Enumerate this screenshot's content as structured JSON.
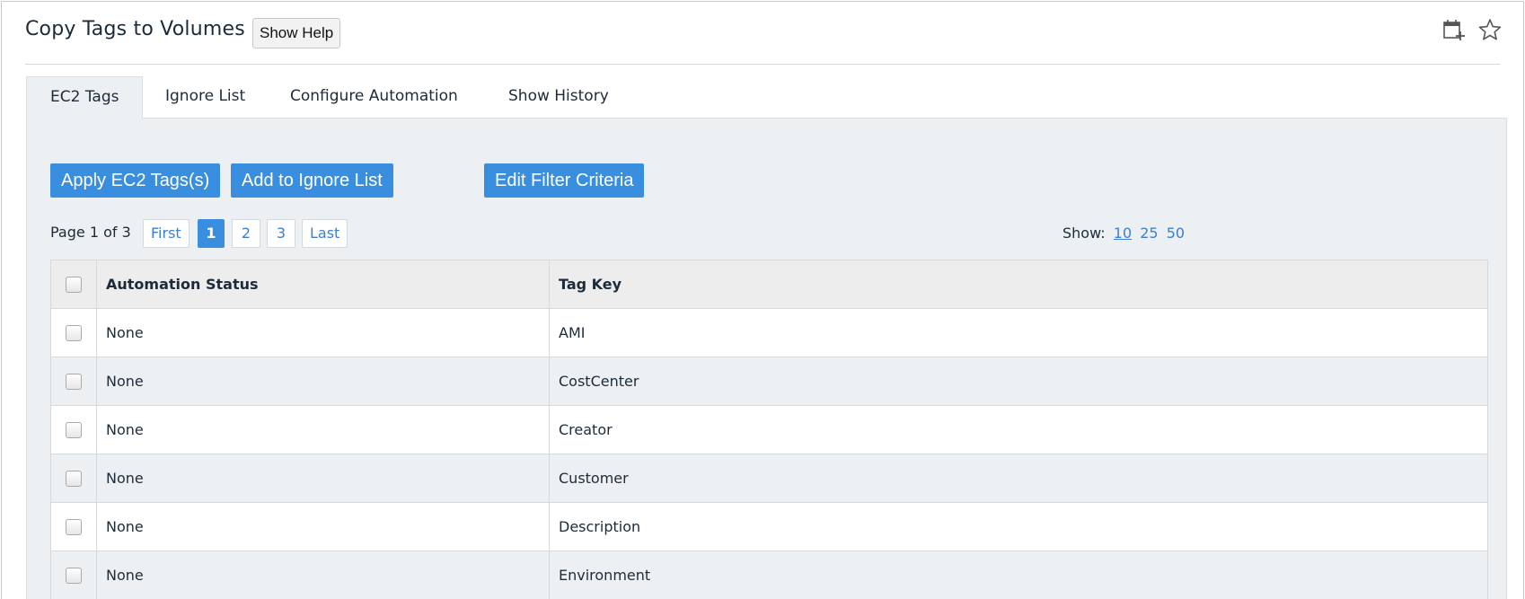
{
  "header": {
    "title": "Copy Tags to Volumes",
    "help_label": "Show Help",
    "icons": [
      "add-to-dashboard-icon",
      "star-icon"
    ]
  },
  "tabs": [
    {
      "label": "EC2 Tags",
      "active": true
    },
    {
      "label": "Ignore List",
      "active": false
    },
    {
      "label": "Configure Automation",
      "active": false
    },
    {
      "label": "Show History",
      "active": false
    }
  ],
  "actions": {
    "apply_label": "Apply EC2 Tags(s)",
    "ignore_label": "Add to Ignore List",
    "filter_label": "Edit Filter Criteria"
  },
  "pager": {
    "label": "Page 1 of 3",
    "first": "First",
    "pages": [
      "1",
      "2",
      "3"
    ],
    "current_page": "1",
    "last": "Last"
  },
  "show": {
    "label": "Show:",
    "options": [
      "10",
      "25",
      "50"
    ],
    "selected": "10"
  },
  "table": {
    "columns": [
      "Automation Status",
      "Tag Key"
    ],
    "rows": [
      {
        "status": "None",
        "tag_key": "AMI"
      },
      {
        "status": "None",
        "tag_key": "CostCenter"
      },
      {
        "status": "None",
        "tag_key": "Creator"
      },
      {
        "status": "None",
        "tag_key": "Customer"
      },
      {
        "status": "None",
        "tag_key": "Description"
      },
      {
        "status": "None",
        "tag_key": "Environment"
      }
    ]
  },
  "colors": {
    "accent": "#3a8ee0",
    "link": "#3a7fd0",
    "panel_bg": "#ecf0f2",
    "header_bg": "#ededed"
  }
}
